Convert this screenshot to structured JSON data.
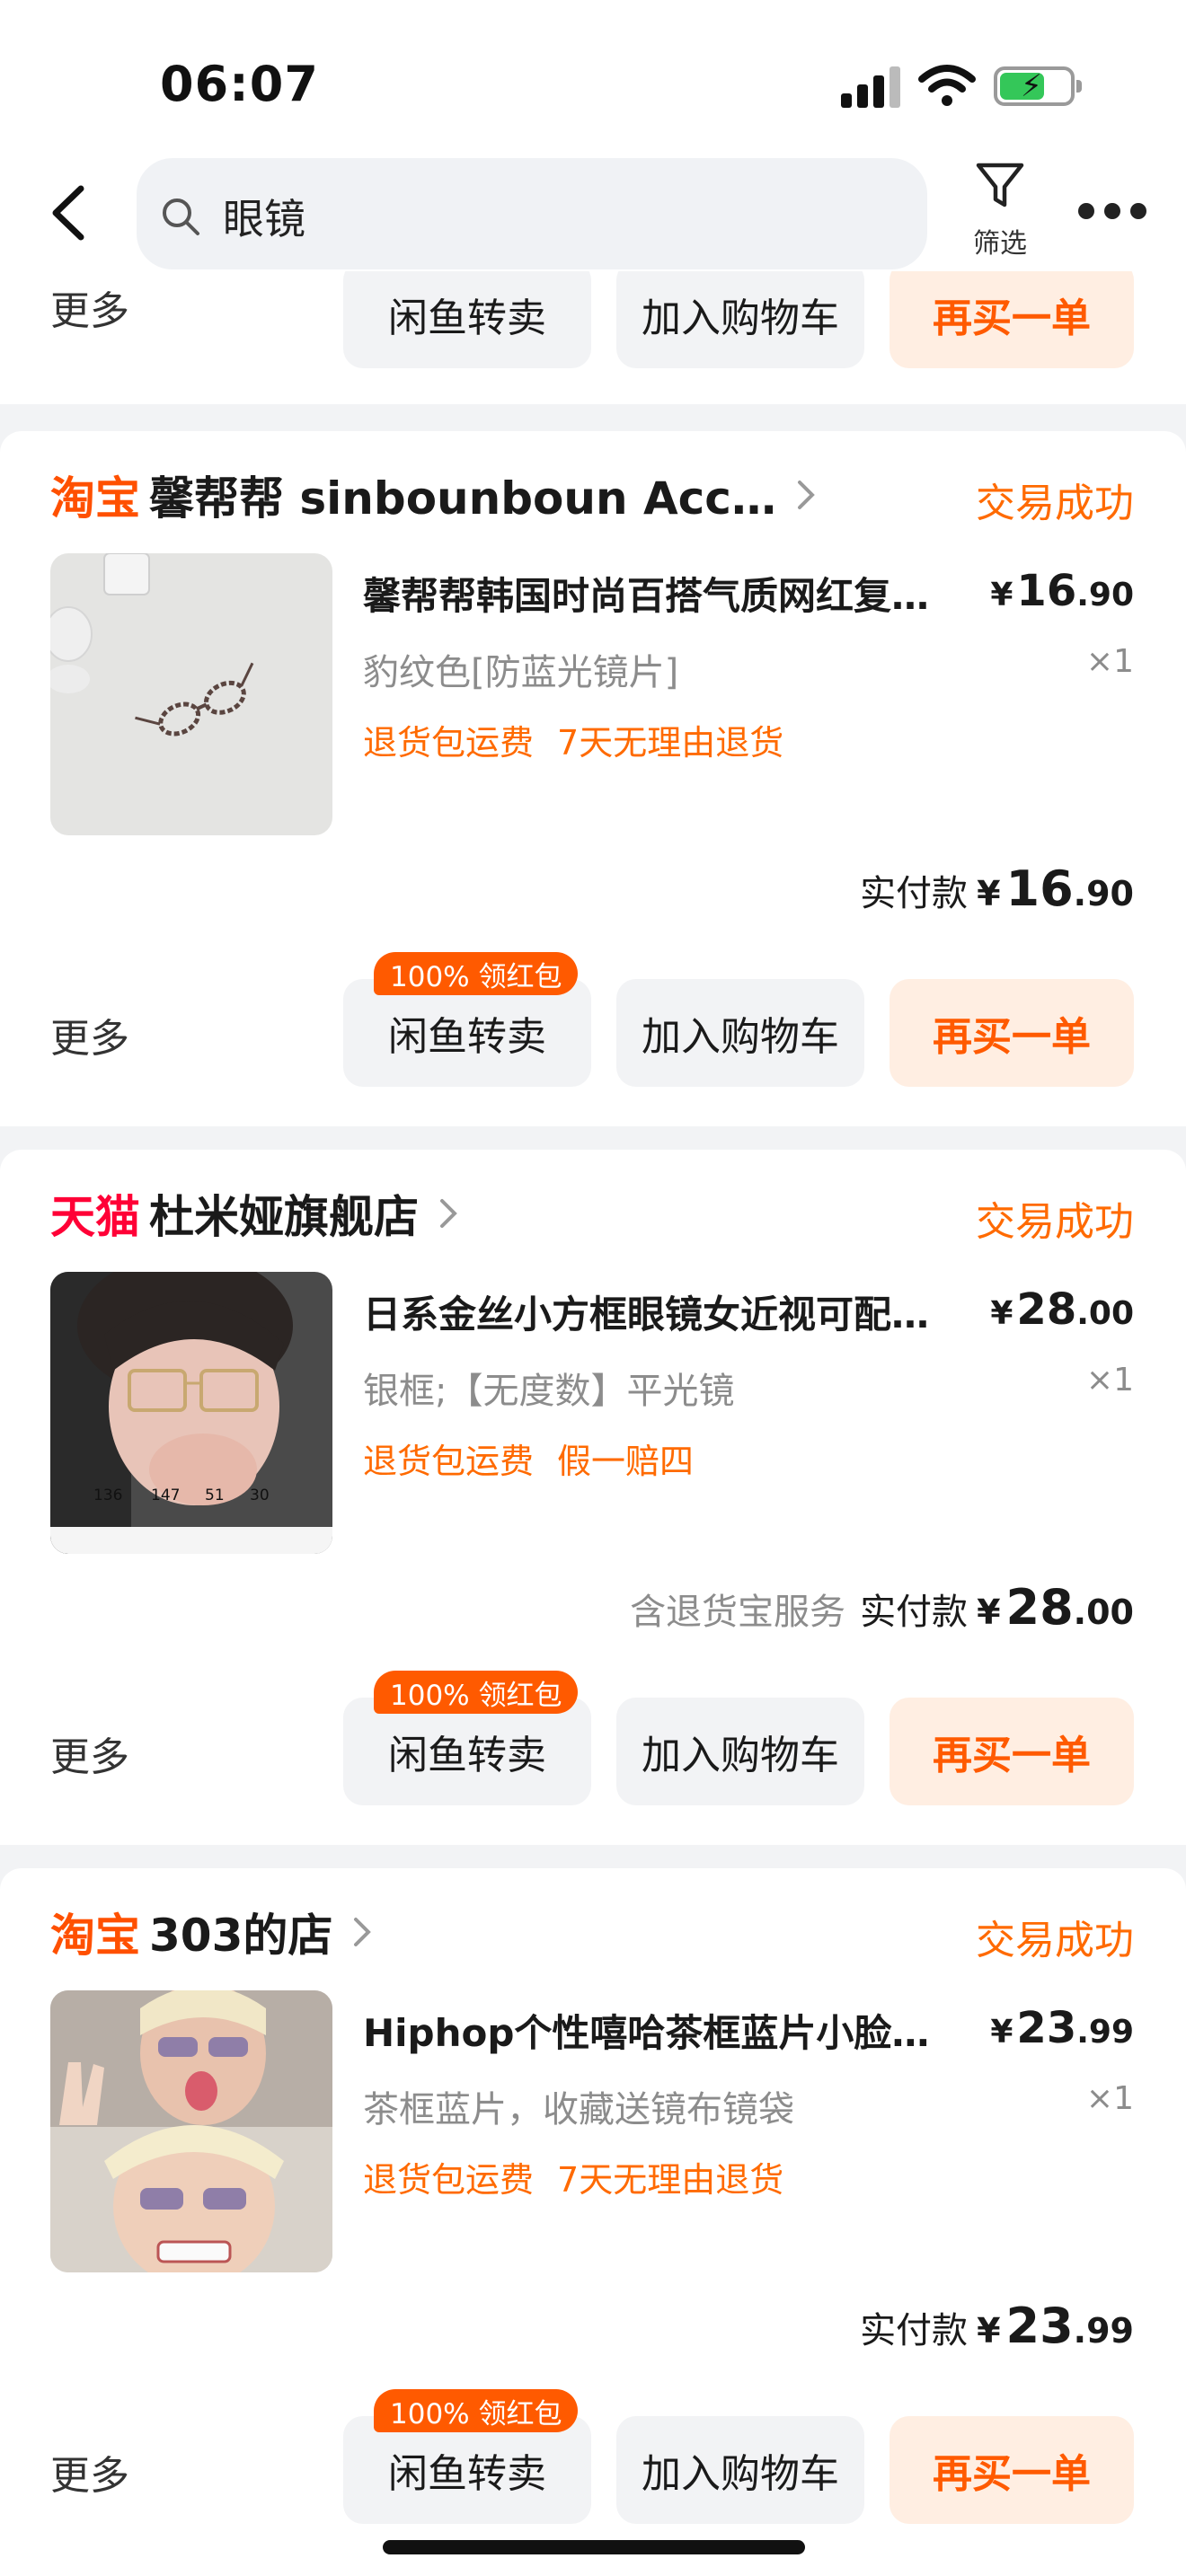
{
  "status_bar": {
    "time": "06:07"
  },
  "header": {
    "search_query": "眼镜",
    "filter_label": "筛选"
  },
  "labels": {
    "more": "更多",
    "resell": "闲鱼转卖",
    "add_cart": "加入购物车",
    "rebuy": "再买一单",
    "paid": "实付款",
    "yen": "¥"
  },
  "orders": [
    {
      "platform": "淘宝",
      "store": "馨帮帮 sinbounboun Acc…",
      "status": "交易成功",
      "title": "馨帮帮韩国时尚百搭气质网红复…",
      "price_int": "16",
      "price_dec": ".90",
      "sku": "豹纹色[防蓝光镜片]",
      "qty": "×1",
      "tags": [
        "退货包运费",
        "7天无理由退货"
      ],
      "service": "",
      "paid_int": "16",
      "paid_dec": ".90",
      "badge": "100% 领红包"
    },
    {
      "platform": "天猫",
      "store": "杜米娅旗舰店",
      "status": "交易成功",
      "title": "日系金丝小方框眼镜女近视可配…",
      "price_int": "28",
      "price_dec": ".00",
      "sku": "银框;【无度数】平光镜",
      "qty": "×1",
      "tags": [
        "退货包运费",
        "假一赔四"
      ],
      "service": "含退货宝服务",
      "paid_int": "28",
      "paid_dec": ".00",
      "badge": "100% 领红包",
      "thumb_specs": [
        "136",
        "147",
        "51",
        "30"
      ]
    },
    {
      "platform": "淘宝",
      "store": "303的店",
      "status": "交易成功",
      "title": "Hiphop个性嘻哈茶框蓝片小脸…",
      "price_int": "23",
      "price_dec": ".99",
      "sku": "茶框蓝片，收藏送镜布镜袋",
      "qty": "×1",
      "tags": [
        "退货包运费",
        "7天无理由退货"
      ],
      "service": "",
      "paid_int": "23",
      "paid_dec": ".99",
      "badge": "100% 领红包"
    }
  ]
}
